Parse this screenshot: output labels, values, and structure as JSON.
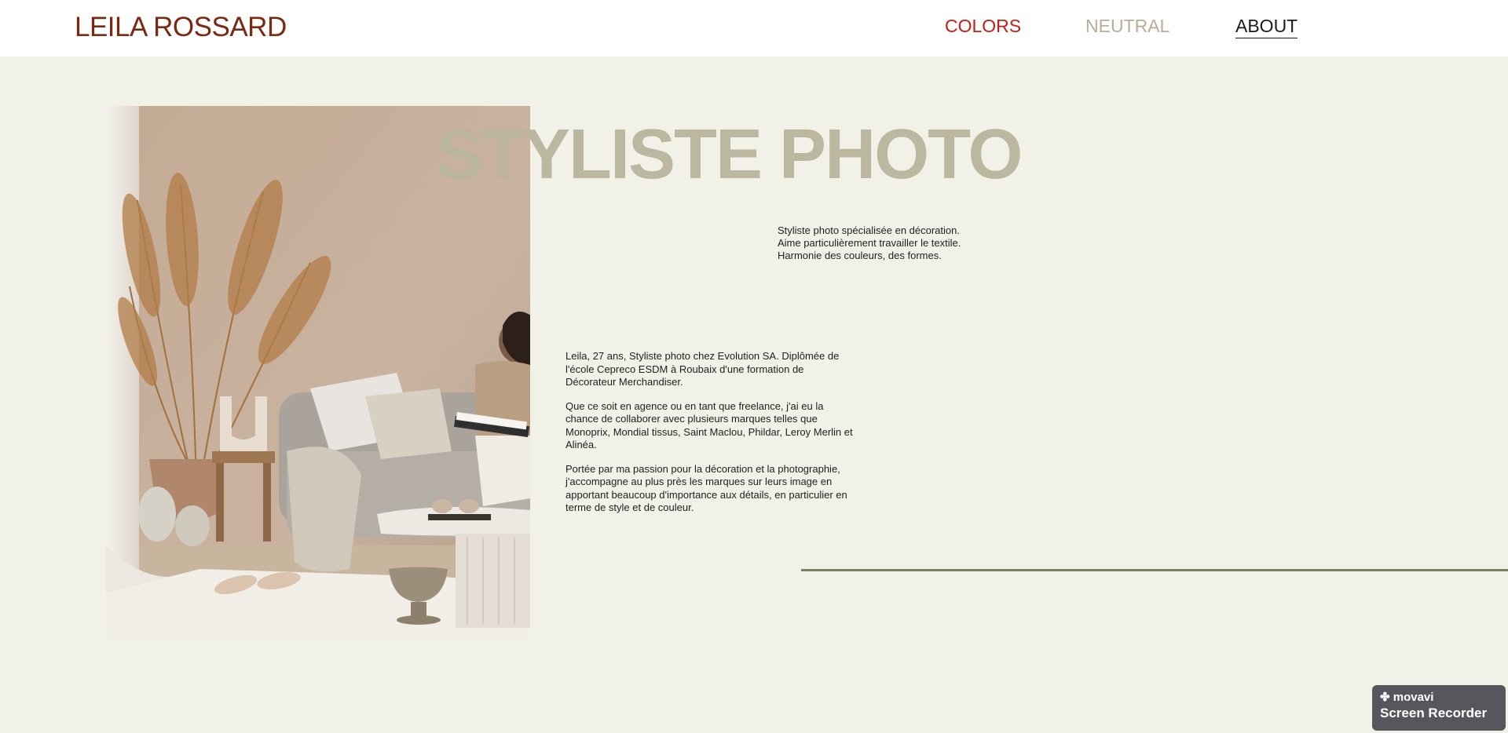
{
  "header": {
    "logo": "LEILA ROSSARD",
    "nav": [
      {
        "label": "COLORS",
        "color": "#cc1a14"
      },
      {
        "label": "NEUTRAL",
        "color": "#b9ae95"
      },
      {
        "label": "ABOUT",
        "color": "#1b1b1b",
        "active": true
      }
    ]
  },
  "hero": {
    "title": "STYLISTE PHOTO",
    "image_alt": "woman-reading-on-beige-sofa-interior"
  },
  "intro": {
    "lines": [
      "Styliste photo spécialisée en décoration.",
      "Aime particulièrement travailler le textile.",
      "Harmonie des couleurs, des formes."
    ]
  },
  "bio": {
    "paragraphs": [
      "Leila, 27 ans, Styliste photo chez Evolution SA. Diplômée de l'école Cepreco ESDM à Roubaix d'une formation de Décorateur Merchandiser.",
      "Que ce soit en agence ou en tant que freelance, j'ai eu la chance de collaborer avec plusieurs marques telles que Monoprix, Mondial tissus, Saint Maclou, Phildar, Leroy Merlin et Alinéa.",
      "Portée par ma passion pour la décoration et la photographie, j'accompagne au plus près les marques sur leurs image en apportant beaucoup d'importance aux détails, en particulier en terme de style et de couleur."
    ]
  },
  "overlay": {
    "brand": "movavi",
    "product": "Screen Recorder"
  },
  "colors": {
    "background": "#f2f1e8",
    "logo": "#7a2a12",
    "title": "#bab69e",
    "divider": "#7e8066"
  }
}
